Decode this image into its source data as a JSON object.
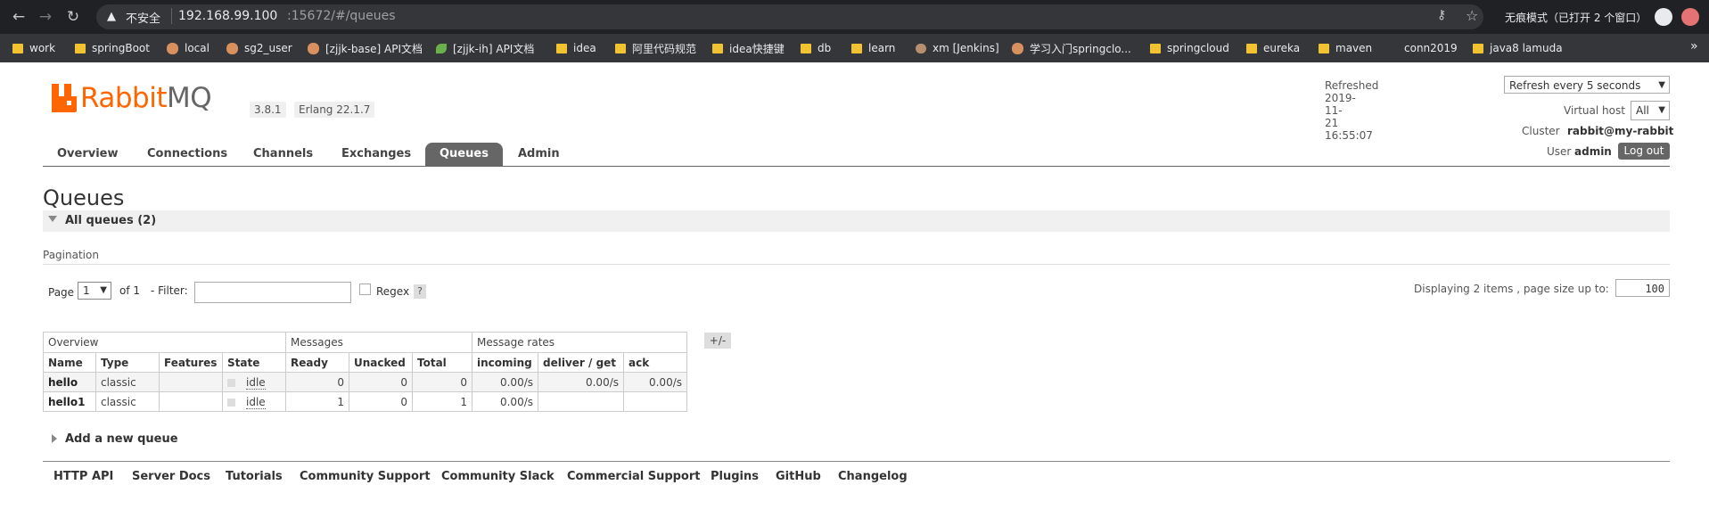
{
  "browser": {
    "security_label": "不安全",
    "url_host": "192.168.99.100",
    "url_rest": ":15672/#/queues",
    "incognito_text": "无痕模式（已打开 2 个窗口）",
    "bookmarks": [
      {
        "label": "work",
        "icon": "folder-icon"
      },
      {
        "label": "springBoot",
        "icon": "folder-icon"
      },
      {
        "label": "local",
        "icon": "site-icon"
      },
      {
        "label": "sg2_user",
        "icon": "site-icon"
      },
      {
        "label": "[zjjk-base] API文档",
        "icon": "site-icon"
      },
      {
        "label": "[zjjk-ih] API文档",
        "icon": "leaf-icon"
      },
      {
        "label": "idea",
        "icon": "folder-icon"
      },
      {
        "label": "阿里代码规范",
        "icon": "folder-icon"
      },
      {
        "label": "idea快捷键",
        "icon": "folder-icon"
      },
      {
        "label": "db",
        "icon": "folder-icon"
      },
      {
        "label": "learn",
        "icon": "folder-icon"
      },
      {
        "label": "xm [Jenkins]",
        "icon": "jenkins-icon"
      },
      {
        "label": "学习入门springclo...",
        "icon": "site-icon"
      },
      {
        "label": "springcloud",
        "icon": "folder-icon"
      },
      {
        "label": "eureka",
        "icon": "folder-icon"
      },
      {
        "label": "maven",
        "icon": "folder-icon"
      },
      {
        "label": "conn2019",
        "icon": "page-icon"
      },
      {
        "label": "java8 lamuda",
        "icon": "folder-icon"
      }
    ],
    "more": "»"
  },
  "header": {
    "logo_rabbit": "Rabbit",
    "logo_mq": "MQ",
    "version": "3.8.1",
    "erlang": "Erlang 22.1.7",
    "refreshed": "Refreshed 2019-11-21 16:55:07",
    "refresh_option": "Refresh every 5 seconds",
    "virtual_host_label": "Virtual host",
    "virtual_host_value": "All",
    "cluster_label": "Cluster",
    "cluster_value": "rabbit@my-rabbit",
    "user_label": "User",
    "user_value": "admin",
    "logout": "Log out"
  },
  "tabs": [
    "Overview",
    "Connections",
    "Channels",
    "Exchanges",
    "Queues",
    "Admin"
  ],
  "active_tab": "Queues",
  "page": {
    "title": "Queues",
    "section": "All queues (2)",
    "pagination_label": "Pagination",
    "page_label": "Page",
    "page_value": "1",
    "of_label": "of 1",
    "filter_label": "- Filter:",
    "regex_label": "Regex",
    "help": "?",
    "displaying": "Displaying 2 items , page size up to:",
    "page_size": "100"
  },
  "table": {
    "groups": [
      "Overview",
      "Messages",
      "Message rates"
    ],
    "plusminus": "+/-",
    "columns": [
      "Name",
      "Type",
      "Features",
      "State",
      "Ready",
      "Unacked",
      "Total",
      "incoming",
      "deliver / get",
      "ack"
    ],
    "rows": [
      {
        "name": "hello",
        "type": "classic",
        "features": "",
        "state": "idle",
        "ready": "0",
        "unacked": "0",
        "total": "0",
        "incoming": "0.00/s",
        "deliver": "0.00/s",
        "ack": "0.00/s"
      },
      {
        "name": "hello1",
        "type": "classic",
        "features": "",
        "state": "idle",
        "ready": "1",
        "unacked": "0",
        "total": "1",
        "incoming": "0.00/s",
        "deliver": "",
        "ack": ""
      }
    ]
  },
  "add_queue": "Add a new queue",
  "footer": [
    "HTTP API",
    "Server Docs",
    "Tutorials",
    "Community Support",
    "Community Slack",
    "Commercial Support",
    "Plugins",
    "GitHub",
    "Changelog"
  ]
}
